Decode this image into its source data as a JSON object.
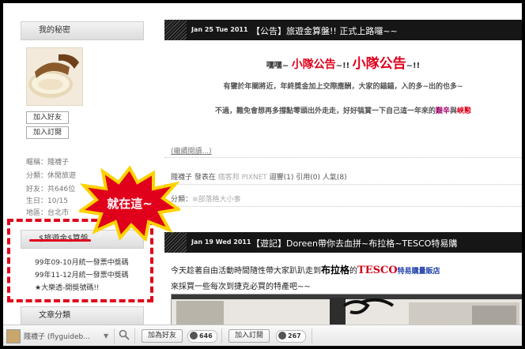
{
  "sidebar": {
    "secret_title": "我的秘密",
    "add_friend": "加入好友",
    "add_subscribe": "加入訂閱",
    "profile": [
      {
        "label": "暱稱：",
        "value": "賤襪子"
      },
      {
        "label": "分類：",
        "value": "休閒旅遊"
      },
      {
        "label": "好友：",
        "value": "共646位"
      },
      {
        "label": "生日：",
        "value": "10/15"
      },
      {
        "label": "地區：",
        "value": "台北市"
      }
    ],
    "links_title": "$旅遊金$算盤",
    "links": [
      "99年09-10月統一發票中獎碼",
      "99年11-12月統一發票中獎碼",
      "★大樂透-開獎號碼!!"
    ],
    "category_title": "文章分類"
  },
  "callout": {
    "text": "就在這~"
  },
  "post1": {
    "date": "Jan 25 Tue 2011",
    "title": "【公告】旅遊金算盤!! 正式上路囉~~",
    "line1_pre": "嘿嘿~ ",
    "line1_a": "小隊公告",
    "line1_mid": "~!! ",
    "line1_b": "小隊公告",
    "line1_post": "~!!",
    "line2": "有鑒於年關將近，年終獎金加上交際應酬，大家的錨錨，入的多~出的也多~",
    "line3_pre": "不過，難免會想再多撐點零頭出外走走，好好犒賞一下自己這一年來的",
    "line3_red": "艱辛",
    "line3_mid": "與",
    "line3_red2": "峽懃",
    "continue": "(繼續閱讀...)",
    "meta_author": "賤襪子 發表在",
    "meta_site": "痞客邦 PIXNET",
    "meta_rest": "迴響(1) 引用(0) 人氣(8)",
    "cat_label": "分類：",
    "cat_value": "≡部落格大小事"
  },
  "post2": {
    "date": "Jan 19 Wed 2011",
    "title": "【遊記】Doreen帶你去血拼~布拉格~TESCO特易購",
    "line1_pre": "今天趁著自由活動時間隨性帶大家趴趴走到",
    "line1_bold": "布拉格",
    "line1_mid": "的",
    "line1_tesco": "TESCO",
    "line1_tail": "特易購量販店",
    "line2": "來採買一些每次到捷克必買的特產吧~~"
  },
  "toolbar": {
    "user": "賤襪子 (flyguideb...",
    "add_friend": "加為好友",
    "friend_count": "646",
    "add_subscribe": "加入訂閱",
    "subscribe_count": "267"
  },
  "colors": {
    "accent_red": "#e0001b",
    "header_dark": "#161616",
    "tesco_red": "#d0021b",
    "tesco_blue": "#1f3fa9"
  }
}
